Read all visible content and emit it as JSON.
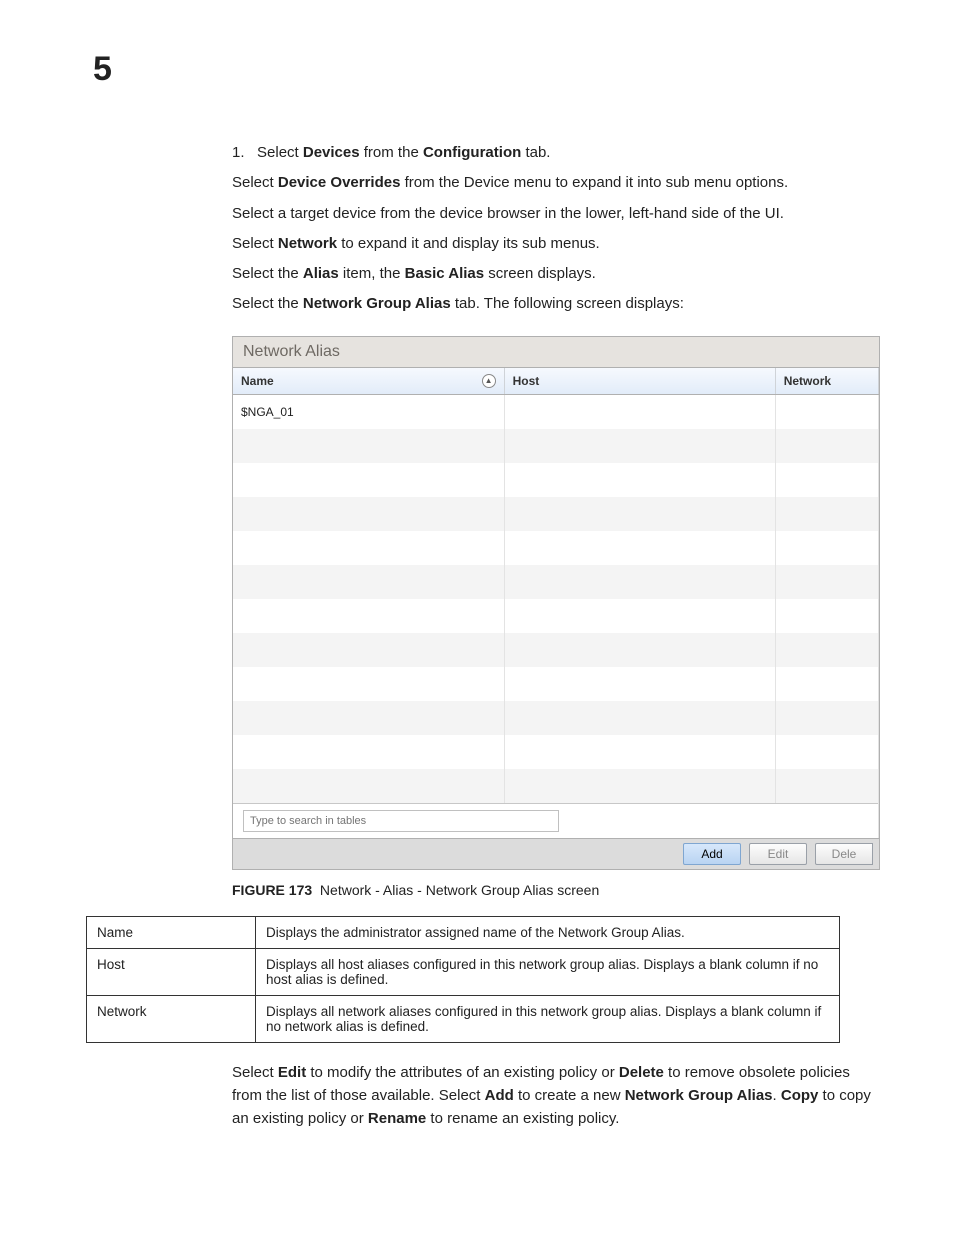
{
  "page_number": "5",
  "steps": {
    "step1_pre": "Select ",
    "step1_b1": "Devices",
    "step1_mid": " from the ",
    "step1_b2": "Configuration",
    "step1_post": " tab.",
    "s2_pre": "Select ",
    "s2_b1": "Device Overrides",
    "s2_post": " from the Device menu to expand it into sub menu options.",
    "s3": "Select a target device from the device browser in the lower, left-hand side of the UI.",
    "s4_pre": "Select ",
    "s4_b1": "Network",
    "s4_post": " to expand it and display its sub menus.",
    "s5_pre": "Select the ",
    "s5_b1": "Alias",
    "s5_mid": " item, the ",
    "s5_b2": "Basic Alias",
    "s5_post": " screen displays.",
    "s6_pre": "Select the ",
    "s6_b1": "Network Group Alias",
    "s6_post": " tab. The following screen displays:"
  },
  "panel": {
    "title": "Network Alias",
    "columns": {
      "name": "Name",
      "host": "Host",
      "network": "Network"
    },
    "rows": [
      {
        "name": "$NGA_01",
        "host": "",
        "network": ""
      },
      {
        "name": "",
        "host": "",
        "network": ""
      },
      {
        "name": "",
        "host": "",
        "network": ""
      },
      {
        "name": "",
        "host": "",
        "network": ""
      },
      {
        "name": "",
        "host": "",
        "network": ""
      },
      {
        "name": "",
        "host": "",
        "network": ""
      },
      {
        "name": "",
        "host": "",
        "network": ""
      },
      {
        "name": "",
        "host": "",
        "network": ""
      },
      {
        "name": "",
        "host": "",
        "network": ""
      },
      {
        "name": "",
        "host": "",
        "network": ""
      },
      {
        "name": "",
        "host": "",
        "network": ""
      },
      {
        "name": "",
        "host": "",
        "network": ""
      }
    ],
    "search_placeholder": "Type to search in tables",
    "buttons": {
      "add": "Add",
      "edit": "Edit",
      "delete": "Dele"
    }
  },
  "caption": {
    "fig": "FIGURE 173",
    "text": "Network - Alias - Network Group Alias screen"
  },
  "desc": [
    {
      "k": "Name",
      "v": "Displays the administrator assigned name of the Network Group Alias."
    },
    {
      "k": "Host",
      "v": "Displays all host aliases configured in this network group alias. Displays a blank column if no host alias is defined."
    },
    {
      "k": "Network",
      "v": "Displays all network aliases configured in this network group alias. Displays a blank column if no network alias is defined."
    }
  ],
  "closing": {
    "t1": "Select ",
    "b1": "Edit",
    "t2": " to modify the attributes of an existing policy or ",
    "b2": "Delete",
    "t3": " to remove obsolete policies from the list of those available. Select ",
    "b3": "Add",
    "t4": " to create a new ",
    "b4": "Network Group Alias",
    "t5": ". ",
    "b5": "Copy",
    "t6": " to copy an existing policy or ",
    "b6": "Rename",
    "t7": " to rename an existing policy."
  }
}
